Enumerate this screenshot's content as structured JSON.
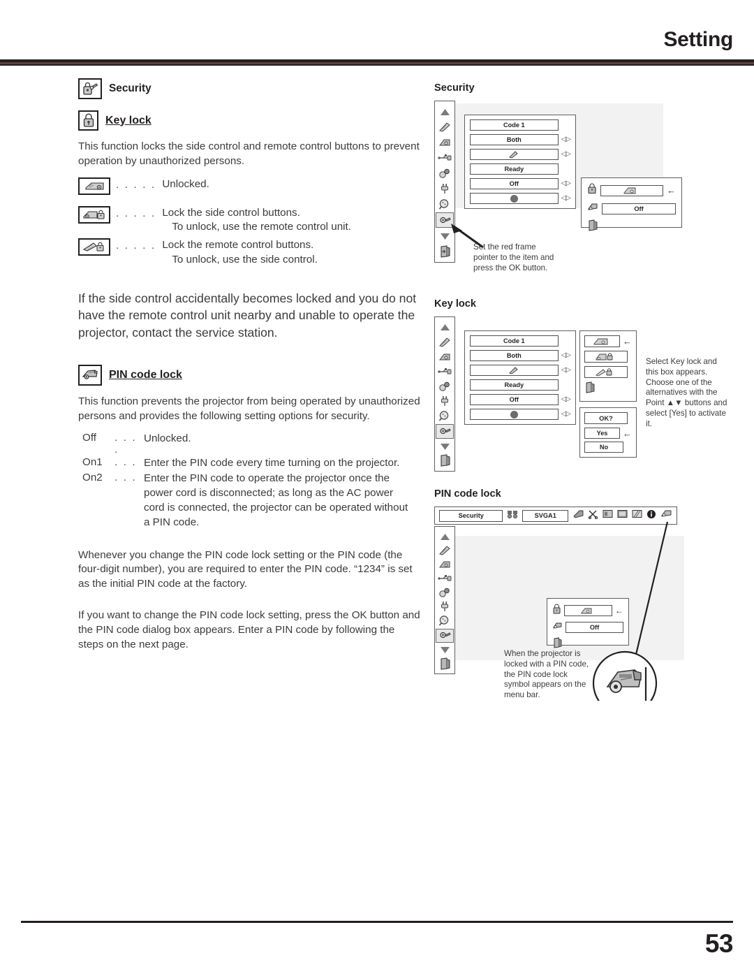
{
  "header": {
    "title": "Setting"
  },
  "footer": {
    "page_number": "53"
  },
  "left": {
    "security_heading": "Security",
    "security_icon": "padlock-key-icon",
    "keylock_heading": "Key lock",
    "keylock_icon": "padlock-icon",
    "keylock_intro": "This function locks the side control and remote control buttons to prevent operation by unauthorized persons.",
    "keylock_options": [
      {
        "icon": "projector-unlocked-icon",
        "dots": ". . . . .",
        "text": "Unlocked.",
        "sub": ""
      },
      {
        "icon": "projector-locked-icon",
        "dots": ". . . . .",
        "text": "Lock the side control buttons.",
        "sub": "To unlock, use the remote control unit."
      },
      {
        "icon": "remote-locked-icon",
        "dots": ". . . . .",
        "text": "Lock the remote control buttons.",
        "sub": "To unlock, use the side control."
      }
    ],
    "warning_paragraph": "If the side control accidentally becomes locked and you do not have the remote control unit nearby and unable to operate the projector, contact the service station.",
    "pincode_heading": "PIN code lock",
    "pincode_icon": "pin-code-lock-icon",
    "pincode_intro": "This function prevents the projector from being operated by unauthorized persons and provides the following setting options for security.",
    "pincode_options": [
      {
        "key": "Off",
        "dots": ". . . .",
        "desc": "Unlocked."
      },
      {
        "key": "On1",
        "dots": ". . .",
        "desc": "Enter the PIN code every time turning on the projector."
      },
      {
        "key": "On2",
        "dots": ". . .",
        "desc": "Enter the PIN code to operate the projector once the power cord is disconnected; as long as the AC power cord is connected, the projector can be operated without a PIN code."
      }
    ],
    "para_change": "Whenever you change the PIN code lock setting or the PIN code (the four-digit number), you are required to enter the PIN code. “1234” is set as the initial PIN code at the factory.",
    "para_dialog": "If you want to change the PIN code lock setting, press the OK button and the PIN code dialog box appears. Enter a PIN code by following the steps on the next page."
  },
  "figures": {
    "security": {
      "title": "Security",
      "sidebar_icons": [
        "up-arrow-icon",
        "remote-icon",
        "projector-icon",
        "usb-icon",
        "sound-icon",
        "plug-icon",
        "search-icon",
        "security-key-icon",
        "down-arrow-icon",
        "exit-door-icon"
      ],
      "selected_sidebar_icon": "security-key-icon",
      "menu_items": [
        {
          "label": "Code 1",
          "has_arrows": false
        },
        {
          "label": "Both",
          "has_arrows": true
        },
        {
          "label": "",
          "icon": "pointer-icon",
          "has_arrows": true
        },
        {
          "label": "Ready",
          "has_arrows": false
        },
        {
          "label": "Off",
          "has_arrows": true
        },
        {
          "label": "",
          "icon": "dot-icon",
          "has_arrows": true
        }
      ],
      "submenu": [
        {
          "icon": "padlock-icon",
          "value_icon": "projector-icon",
          "value": "",
          "pointer": true
        },
        {
          "icon": "pin-key-icon",
          "value": "Off",
          "pointer": false
        },
        {
          "icon": "exit-door-icon",
          "value": "",
          "pointer": false
        }
      ],
      "note": "Set the red frame pointer to the item and press the OK button."
    },
    "keylock": {
      "title": "Key lock",
      "menu_items": [
        {
          "label": "Code 1",
          "has_arrows": false
        },
        {
          "label": "Both",
          "has_arrows": true
        },
        {
          "label": "",
          "icon": "pointer-icon",
          "has_arrows": true
        },
        {
          "label": "Ready",
          "has_arrows": false
        },
        {
          "label": "Off",
          "has_arrows": true
        },
        {
          "label": "",
          "icon": "dot-icon",
          "has_arrows": true
        }
      ],
      "choices": [
        {
          "icon": "projector-unlocked-icon",
          "pointer": true
        },
        {
          "icon": "projector-locked-icon",
          "pointer": false
        },
        {
          "icon": "remote-locked-icon",
          "pointer": false
        },
        {
          "icon": "exit-door-icon",
          "pointer": false
        }
      ],
      "confirm": {
        "prompt": "OK?",
        "yes": "Yes",
        "no": "No",
        "pointer_on": "Yes"
      },
      "note": "Select Key lock and this box appears. Choose one of the alternatives with the Point ▲▼ buttons and select [Yes] to activate it."
    },
    "pincode": {
      "title": "PIN code lock",
      "menu_bar": {
        "label": "Security",
        "binocular_icon": "binocular-icon",
        "source": "SVGA1",
        "icons": [
          "screen-icon",
          "scissors-icon",
          "image-icon",
          "screen2-icon",
          "pattern-icon",
          "info-icon",
          "pin-lock-icon"
        ]
      },
      "submenu": [
        {
          "icon": "padlock-icon",
          "value_icon": "projector-icon",
          "value": "",
          "pointer": true
        },
        {
          "icon": "pin-key-icon",
          "value": "Off",
          "pointer": false
        },
        {
          "icon": "exit-door-icon",
          "value": "",
          "pointer": false
        }
      ],
      "note": "When the projector is locked with a PIN code, the PIN code lock symbol appears on the menu bar.",
      "callout_icon": "pin-code-lock-symbol"
    }
  }
}
